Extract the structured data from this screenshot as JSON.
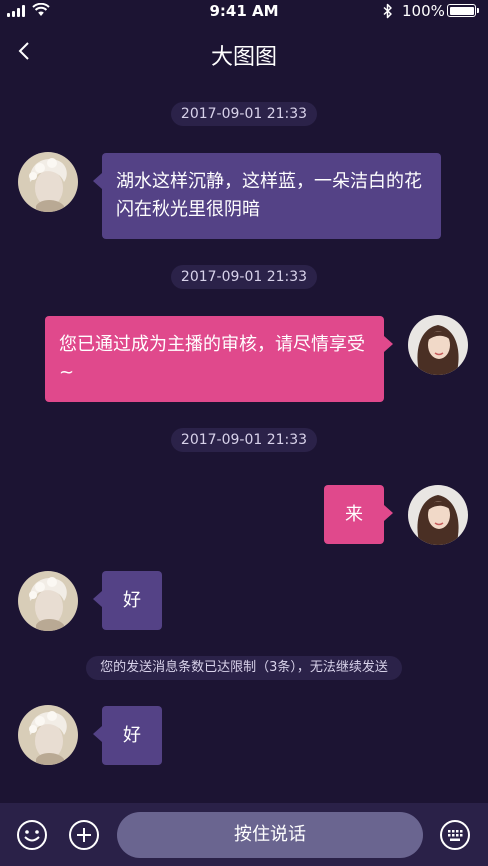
{
  "status_bar": {
    "time": "9:41 AM",
    "battery": "100%"
  },
  "nav": {
    "title": "大图图",
    "back_icon": "chevron-left-icon"
  },
  "messages": [
    {
      "type": "timestamp",
      "text": "2017-09-01    21:33"
    },
    {
      "type": "received",
      "text": "湖水这样沉静，这样蓝，一朵洁白的花闪在秋光里很阴暗"
    },
    {
      "type": "timestamp",
      "text": "2017-09-01    21:33"
    },
    {
      "type": "sent",
      "text": "您已通过成为主播的审核，请尽情享受~"
    },
    {
      "type": "timestamp",
      "text": "2017-09-01    21:33"
    },
    {
      "type": "sent",
      "text": "来"
    },
    {
      "type": "received",
      "text": "好"
    },
    {
      "type": "notice",
      "text": "您的发送消息条数已达限制（3条），无法继续发送"
    },
    {
      "type": "received",
      "text": "好"
    }
  ],
  "input_bar": {
    "emoji_icon": "smiley-icon",
    "add_icon": "plus-circle-icon",
    "voice_label": "按住说话",
    "keyboard_icon": "keyboard-icon"
  },
  "colors": {
    "background": "#1c1433",
    "received_bubble": "#544286",
    "sent_bubble": "#e0498c",
    "input_bar": "#2a2148"
  }
}
